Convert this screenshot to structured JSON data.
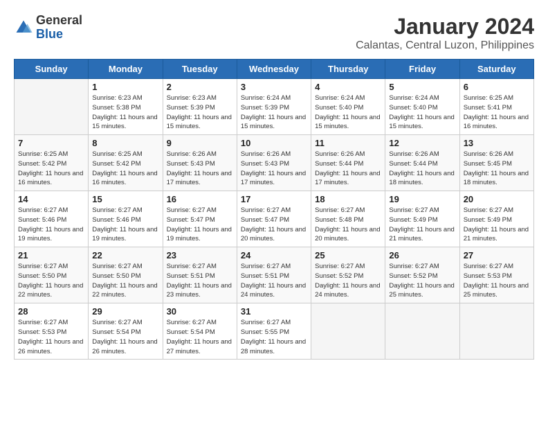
{
  "logo": {
    "general": "General",
    "blue": "Blue"
  },
  "title": "January 2024",
  "subtitle": "Calantas, Central Luzon, Philippines",
  "weekdays": [
    "Sunday",
    "Monday",
    "Tuesday",
    "Wednesday",
    "Thursday",
    "Friday",
    "Saturday"
  ],
  "weeks": [
    [
      {
        "day": "",
        "sunrise": "",
        "sunset": "",
        "daylight": ""
      },
      {
        "day": "1",
        "sunrise": "Sunrise: 6:23 AM",
        "sunset": "Sunset: 5:38 PM",
        "daylight": "Daylight: 11 hours and 15 minutes."
      },
      {
        "day": "2",
        "sunrise": "Sunrise: 6:23 AM",
        "sunset": "Sunset: 5:39 PM",
        "daylight": "Daylight: 11 hours and 15 minutes."
      },
      {
        "day": "3",
        "sunrise": "Sunrise: 6:24 AM",
        "sunset": "Sunset: 5:39 PM",
        "daylight": "Daylight: 11 hours and 15 minutes."
      },
      {
        "day": "4",
        "sunrise": "Sunrise: 6:24 AM",
        "sunset": "Sunset: 5:40 PM",
        "daylight": "Daylight: 11 hours and 15 minutes."
      },
      {
        "day": "5",
        "sunrise": "Sunrise: 6:24 AM",
        "sunset": "Sunset: 5:40 PM",
        "daylight": "Daylight: 11 hours and 15 minutes."
      },
      {
        "day": "6",
        "sunrise": "Sunrise: 6:25 AM",
        "sunset": "Sunset: 5:41 PM",
        "daylight": "Daylight: 11 hours and 16 minutes."
      }
    ],
    [
      {
        "day": "7",
        "sunrise": "Sunrise: 6:25 AM",
        "sunset": "Sunset: 5:42 PM",
        "daylight": "Daylight: 11 hours and 16 minutes."
      },
      {
        "day": "8",
        "sunrise": "Sunrise: 6:25 AM",
        "sunset": "Sunset: 5:42 PM",
        "daylight": "Daylight: 11 hours and 16 minutes."
      },
      {
        "day": "9",
        "sunrise": "Sunrise: 6:26 AM",
        "sunset": "Sunset: 5:43 PM",
        "daylight": "Daylight: 11 hours and 17 minutes."
      },
      {
        "day": "10",
        "sunrise": "Sunrise: 6:26 AM",
        "sunset": "Sunset: 5:43 PM",
        "daylight": "Daylight: 11 hours and 17 minutes."
      },
      {
        "day": "11",
        "sunrise": "Sunrise: 6:26 AM",
        "sunset": "Sunset: 5:44 PM",
        "daylight": "Daylight: 11 hours and 17 minutes."
      },
      {
        "day": "12",
        "sunrise": "Sunrise: 6:26 AM",
        "sunset": "Sunset: 5:44 PM",
        "daylight": "Daylight: 11 hours and 18 minutes."
      },
      {
        "day": "13",
        "sunrise": "Sunrise: 6:26 AM",
        "sunset": "Sunset: 5:45 PM",
        "daylight": "Daylight: 11 hours and 18 minutes."
      }
    ],
    [
      {
        "day": "14",
        "sunrise": "Sunrise: 6:27 AM",
        "sunset": "Sunset: 5:46 PM",
        "daylight": "Daylight: 11 hours and 19 minutes."
      },
      {
        "day": "15",
        "sunrise": "Sunrise: 6:27 AM",
        "sunset": "Sunset: 5:46 PM",
        "daylight": "Daylight: 11 hours and 19 minutes."
      },
      {
        "day": "16",
        "sunrise": "Sunrise: 6:27 AM",
        "sunset": "Sunset: 5:47 PM",
        "daylight": "Daylight: 11 hours and 19 minutes."
      },
      {
        "day": "17",
        "sunrise": "Sunrise: 6:27 AM",
        "sunset": "Sunset: 5:47 PM",
        "daylight": "Daylight: 11 hours and 20 minutes."
      },
      {
        "day": "18",
        "sunrise": "Sunrise: 6:27 AM",
        "sunset": "Sunset: 5:48 PM",
        "daylight": "Daylight: 11 hours and 20 minutes."
      },
      {
        "day": "19",
        "sunrise": "Sunrise: 6:27 AM",
        "sunset": "Sunset: 5:49 PM",
        "daylight": "Daylight: 11 hours and 21 minutes."
      },
      {
        "day": "20",
        "sunrise": "Sunrise: 6:27 AM",
        "sunset": "Sunset: 5:49 PM",
        "daylight": "Daylight: 11 hours and 21 minutes."
      }
    ],
    [
      {
        "day": "21",
        "sunrise": "Sunrise: 6:27 AM",
        "sunset": "Sunset: 5:50 PM",
        "daylight": "Daylight: 11 hours and 22 minutes."
      },
      {
        "day": "22",
        "sunrise": "Sunrise: 6:27 AM",
        "sunset": "Sunset: 5:50 PM",
        "daylight": "Daylight: 11 hours and 22 minutes."
      },
      {
        "day": "23",
        "sunrise": "Sunrise: 6:27 AM",
        "sunset": "Sunset: 5:51 PM",
        "daylight": "Daylight: 11 hours and 23 minutes."
      },
      {
        "day": "24",
        "sunrise": "Sunrise: 6:27 AM",
        "sunset": "Sunset: 5:51 PM",
        "daylight": "Daylight: 11 hours and 24 minutes."
      },
      {
        "day": "25",
        "sunrise": "Sunrise: 6:27 AM",
        "sunset": "Sunset: 5:52 PM",
        "daylight": "Daylight: 11 hours and 24 minutes."
      },
      {
        "day": "26",
        "sunrise": "Sunrise: 6:27 AM",
        "sunset": "Sunset: 5:52 PM",
        "daylight": "Daylight: 11 hours and 25 minutes."
      },
      {
        "day": "27",
        "sunrise": "Sunrise: 6:27 AM",
        "sunset": "Sunset: 5:53 PM",
        "daylight": "Daylight: 11 hours and 25 minutes."
      }
    ],
    [
      {
        "day": "28",
        "sunrise": "Sunrise: 6:27 AM",
        "sunset": "Sunset: 5:53 PM",
        "daylight": "Daylight: 11 hours and 26 minutes."
      },
      {
        "day": "29",
        "sunrise": "Sunrise: 6:27 AM",
        "sunset": "Sunset: 5:54 PM",
        "daylight": "Daylight: 11 hours and 26 minutes."
      },
      {
        "day": "30",
        "sunrise": "Sunrise: 6:27 AM",
        "sunset": "Sunset: 5:54 PM",
        "daylight": "Daylight: 11 hours and 27 minutes."
      },
      {
        "day": "31",
        "sunrise": "Sunrise: 6:27 AM",
        "sunset": "Sunset: 5:55 PM",
        "daylight": "Daylight: 11 hours and 28 minutes."
      },
      {
        "day": "",
        "sunrise": "",
        "sunset": "",
        "daylight": ""
      },
      {
        "day": "",
        "sunrise": "",
        "sunset": "",
        "daylight": ""
      },
      {
        "day": "",
        "sunrise": "",
        "sunset": "",
        "daylight": ""
      }
    ]
  ]
}
